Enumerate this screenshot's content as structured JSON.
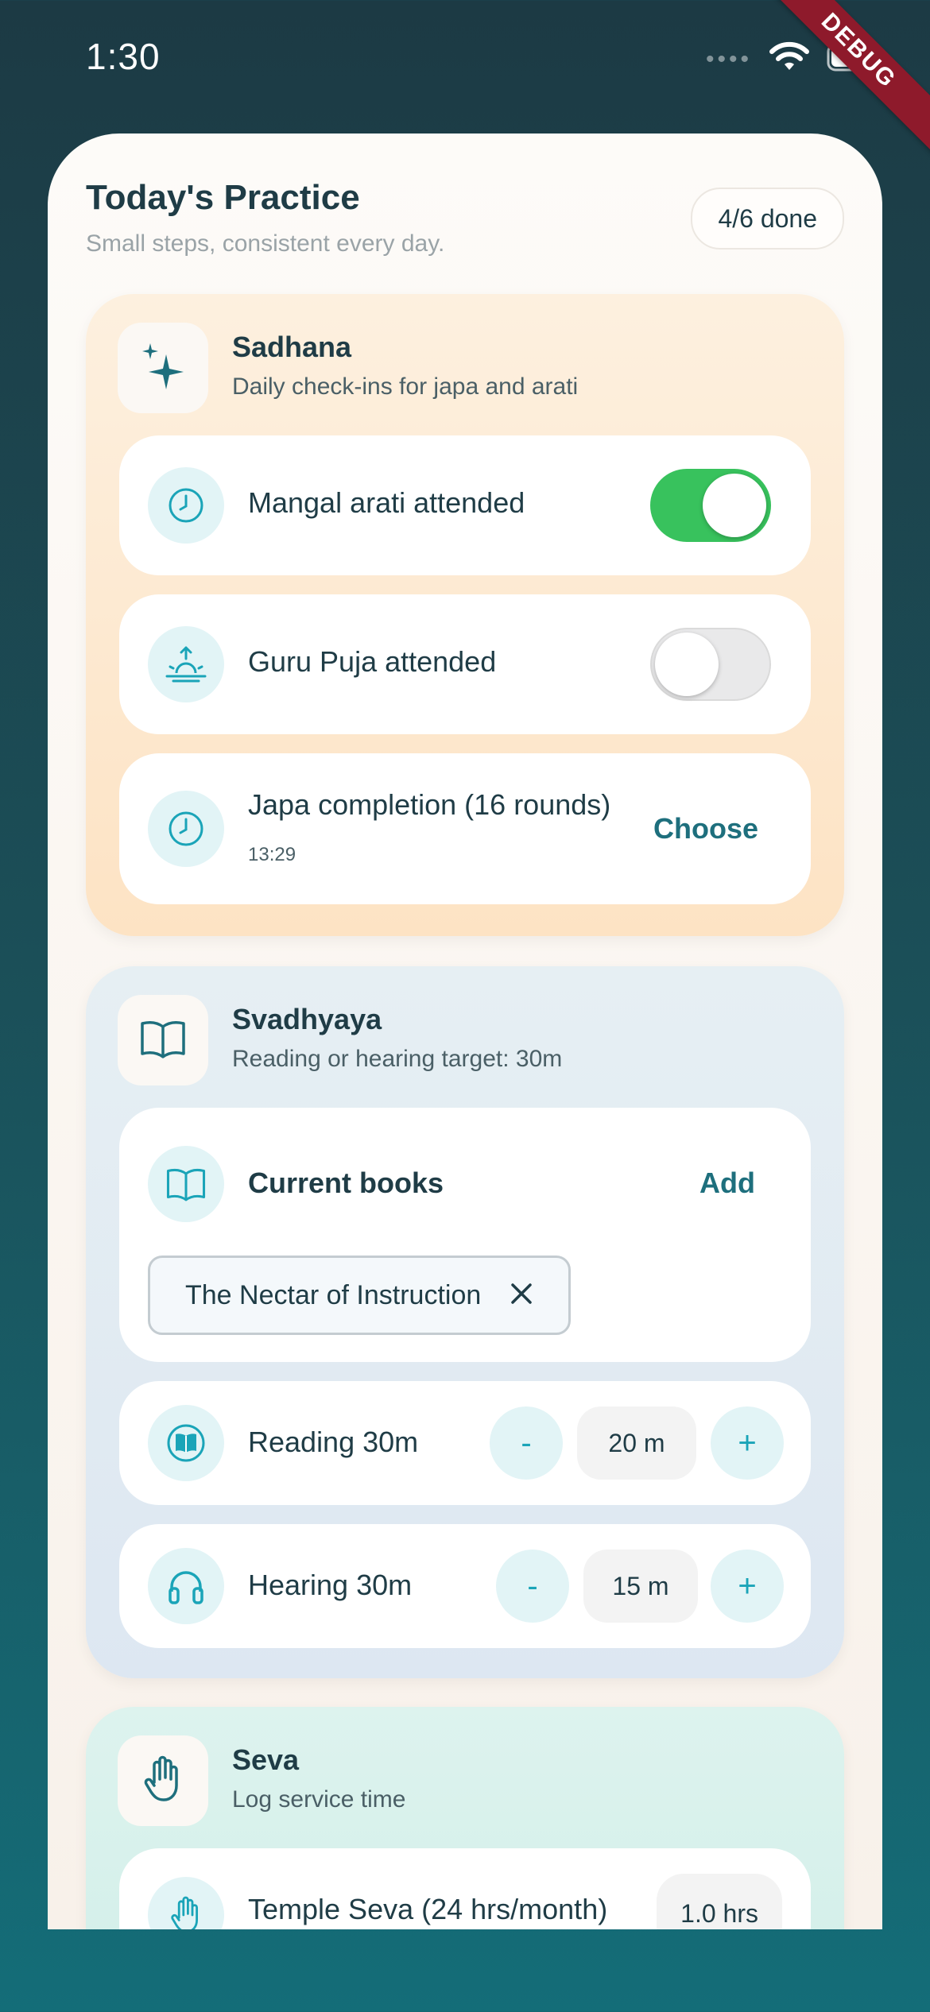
{
  "status_bar": {
    "time": "1:30",
    "signal_dots": "••••",
    "wifi_icon": "wifi-icon",
    "battery_icon": "battery-icon",
    "debug_banner": "DEBUG"
  },
  "header": {
    "title": "Today's Practice",
    "subtitle": "Small steps, consistent every day.",
    "progress": "4/6 done"
  },
  "sadhana": {
    "title": "Sadhana",
    "subtitle": "Daily check-ins for japa and arati",
    "icon": "sparkle-icon",
    "items": [
      {
        "label": "Mangal arati attended",
        "icon": "clock-icon",
        "checked": true
      },
      {
        "label": "Guru Puja attended",
        "icon": "sunrise-icon",
        "checked": false
      }
    ],
    "japa": {
      "label": "Japa completion (16 rounds)",
      "time": "13:29",
      "icon": "clock-icon",
      "action_label": "Choose"
    }
  },
  "svadhyaya": {
    "title": "Svadhyaya",
    "subtitle": "Reading or hearing target: 30m",
    "icon": "book-icon",
    "books": {
      "title": "Current books",
      "add_label": "Add",
      "items": [
        "The Nectar of Instruction"
      ]
    },
    "reading": {
      "label": "Reading 30m",
      "value": "20 m",
      "minus": "-",
      "plus": "+"
    },
    "hearing": {
      "label": "Hearing 30m",
      "value": "15 m",
      "minus": "-",
      "plus": "+"
    }
  },
  "seva": {
    "title": "Seva",
    "subtitle": "Log service time",
    "icon": "hand-icon",
    "items": [
      {
        "label": "Temple Seva (24 hrs/month)",
        "value": "1.0 hrs"
      }
    ]
  },
  "colors": {
    "accent": "#1e6f7d",
    "toggle_on": "#38c25d",
    "icon_tint": "#1aa4b8"
  }
}
